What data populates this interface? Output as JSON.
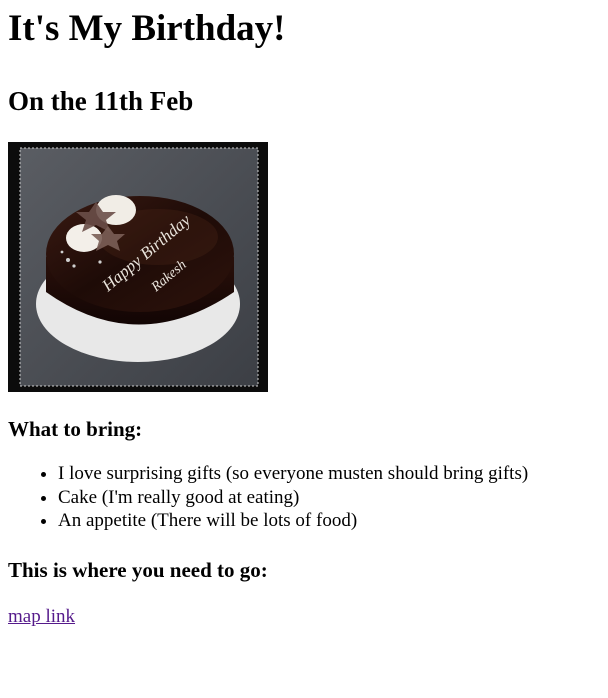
{
  "page": {
    "title": "It's My Birthday!",
    "date_heading": "On the 11th Feb",
    "image": {
      "description_icon": "birthday-cake-image",
      "cake_text_line1": "Happy Birthday",
      "cake_text_line2": "Rakesh"
    },
    "bring_heading": "What to bring:",
    "bring_items": [
      "I love surprising gifts (so everyone musten should bring gifts)",
      "Cake (I'm really good at eating)",
      "An appetite (There will be lots of food)"
    ],
    "location_heading": "This is where you need to go:",
    "map_link_text": "map link"
  },
  "colors": {
    "link_visited": "#551a8b",
    "text": "#000000"
  }
}
